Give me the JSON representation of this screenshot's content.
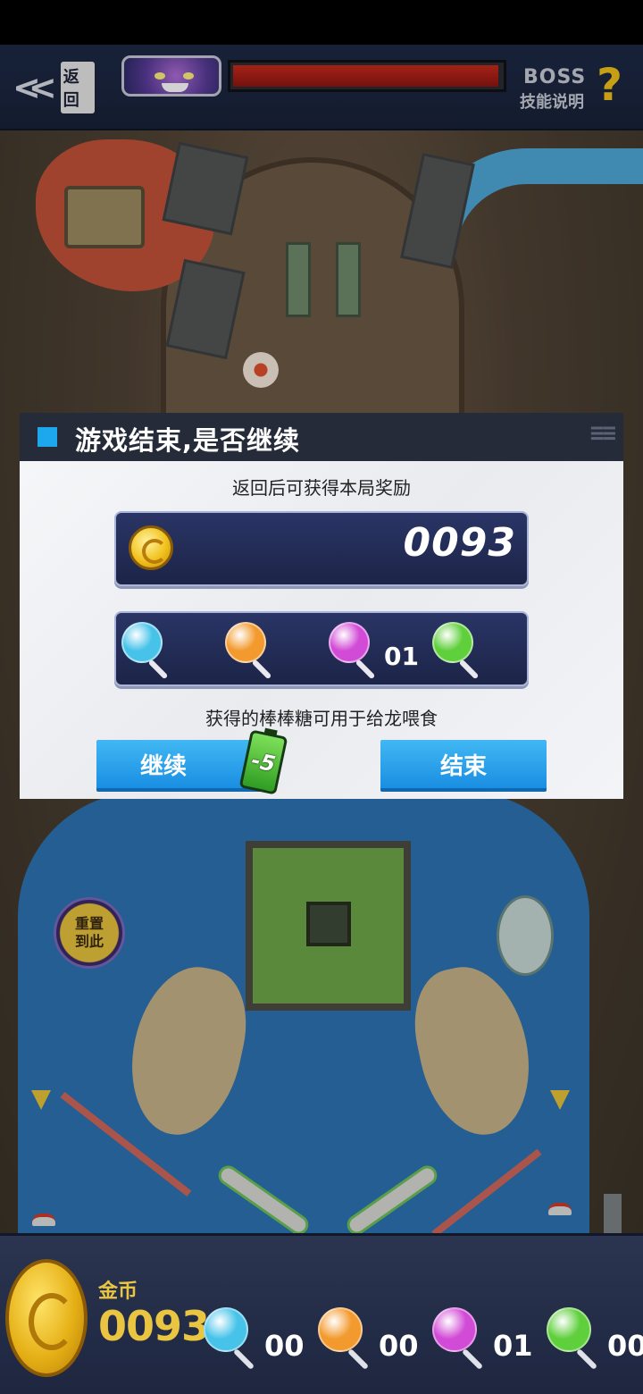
{
  "header": {
    "back_label": "返回",
    "boss_line1": "BOSS",
    "boss_line2": "技能说明",
    "help_glyph": "?"
  },
  "boss_hp": {
    "fraction": 1.0,
    "color": "#c72a1d"
  },
  "playfield": {
    "reset_line1": "重置",
    "reset_line2": "到此"
  },
  "dialog": {
    "title": "游戏结束,是否继续",
    "subtitle": "返回后可获得本局奖励",
    "coin_value": "0093",
    "candies": [
      {
        "name": "blue-candy",
        "color": "#47c3ea",
        "count": ""
      },
      {
        "name": "orange-candy",
        "color": "#f39a2e",
        "count": ""
      },
      {
        "name": "purple-candy",
        "color": "#d24bd6",
        "count": "01"
      },
      {
        "name": "green-candy",
        "color": "#5fcf3c",
        "count": ""
      }
    ],
    "hint": "获得的棒棒糖可用于给龙喂食",
    "continue_label": "继续",
    "battery_cost": "-5",
    "end_label": "结束",
    "accent_color": "#1da8ee"
  },
  "bottom": {
    "gold_label": "金币",
    "gold_value": "0093",
    "candies": [
      {
        "name": "blue-candy",
        "color": "#47c3ea",
        "count": "00"
      },
      {
        "name": "orange-candy",
        "color": "#f39a2e",
        "count": "00"
      },
      {
        "name": "purple-candy",
        "color": "#d24bd6",
        "count": "01"
      },
      {
        "name": "green-candy",
        "color": "#5fcf3c",
        "count": "00"
      }
    ]
  }
}
